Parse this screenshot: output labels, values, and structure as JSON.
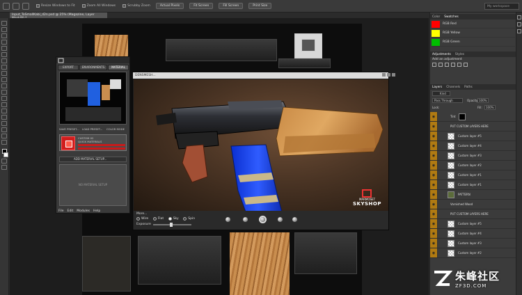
{
  "topbar": {
    "checks": [
      "Resize Windows to Fit",
      "Zoom All Windows",
      "Scrubby Zoom"
    ],
    "buttons": [
      "Actual Pixels",
      "Fit Screen",
      "Fill Screen",
      "Print Size"
    ],
    "workspace": "My workspace"
  },
  "document": {
    "tab": "Input_ToSmallKabi_d2n.psd @ 25% (Magazine, Layer Mask/8) *"
  },
  "skyshop": {
    "tabs": [
      "EXPORT",
      "ENVIRONMENTS",
      "MATERIAL"
    ],
    "preview_buttons": [
      "SAVE PRESET...",
      "LOAD PRESET...",
      "COLOR MODE"
    ],
    "material_name": "CUSTOM 02",
    "material_sub": "QUICK MATERIALS",
    "add_material": "ADD MATERIAL SETUP...",
    "no_material": "NO MATERIAL SETUP",
    "menu": [
      "File",
      "Edit",
      "Modules",
      "Help"
    ]
  },
  "preview": {
    "title": "DENSMESH...",
    "more_label": "More...",
    "modes": [
      "Wire",
      "Flat",
      "Sky",
      "Spin"
    ],
    "selected_mode": "Sky",
    "exposure_label": "Exposure",
    "brand_top": "MARMOSET",
    "brand_main": "SKYSHOP"
  },
  "swatches": {
    "tabs": [
      "Color",
      "Swatches"
    ],
    "items": [
      {
        "name": "RGB Red",
        "color": "#ff0000"
      },
      {
        "name": "RGB Yellow",
        "color": "#ffff00"
      },
      {
        "name": "RGB Green",
        "color": "#00c000"
      }
    ]
  },
  "adjustments": {
    "tabs": [
      "Adjustments",
      "Styles"
    ],
    "hint": "Add an adjustment"
  },
  "layers": {
    "tabs": [
      "Layers",
      "Channels",
      "Paths"
    ],
    "kind": "Kind",
    "blend": "Pass Through",
    "opacity_label": "Opacity:",
    "opacity": "100%",
    "lock_label": "Lock:",
    "fill_label": "Fill:",
    "fill": "100%",
    "items": [
      {
        "name": "Tint",
        "type": "group"
      },
      {
        "name": "PUT CUSTOM LAYERS HERE",
        "type": "group"
      },
      {
        "name": "Custom layer #5",
        "type": "layer"
      },
      {
        "name": "Custom layer #4",
        "type": "layer"
      },
      {
        "name": "Custom layer #3",
        "type": "layer"
      },
      {
        "name": "Custom layer #2",
        "type": "layer"
      },
      {
        "name": "Custom layer #1",
        "type": "layer"
      },
      {
        "name": "Custom layer #1",
        "type": "layer"
      },
      {
        "name": "PATTERN",
        "type": "layer"
      },
      {
        "name": "Varnished Wood",
        "type": "group"
      },
      {
        "name": "PUT CUSTOM LAYERS HERE",
        "type": "group"
      },
      {
        "name": "Custom layer #5",
        "type": "layer"
      },
      {
        "name": "Custom layer #4",
        "type": "layer"
      },
      {
        "name": "Custom layer #3",
        "type": "layer"
      },
      {
        "name": "Custom layer #2",
        "type": "layer"
      }
    ]
  },
  "watermark": {
    "text": "朱峰社区",
    "url": "ZF3D.COM"
  }
}
